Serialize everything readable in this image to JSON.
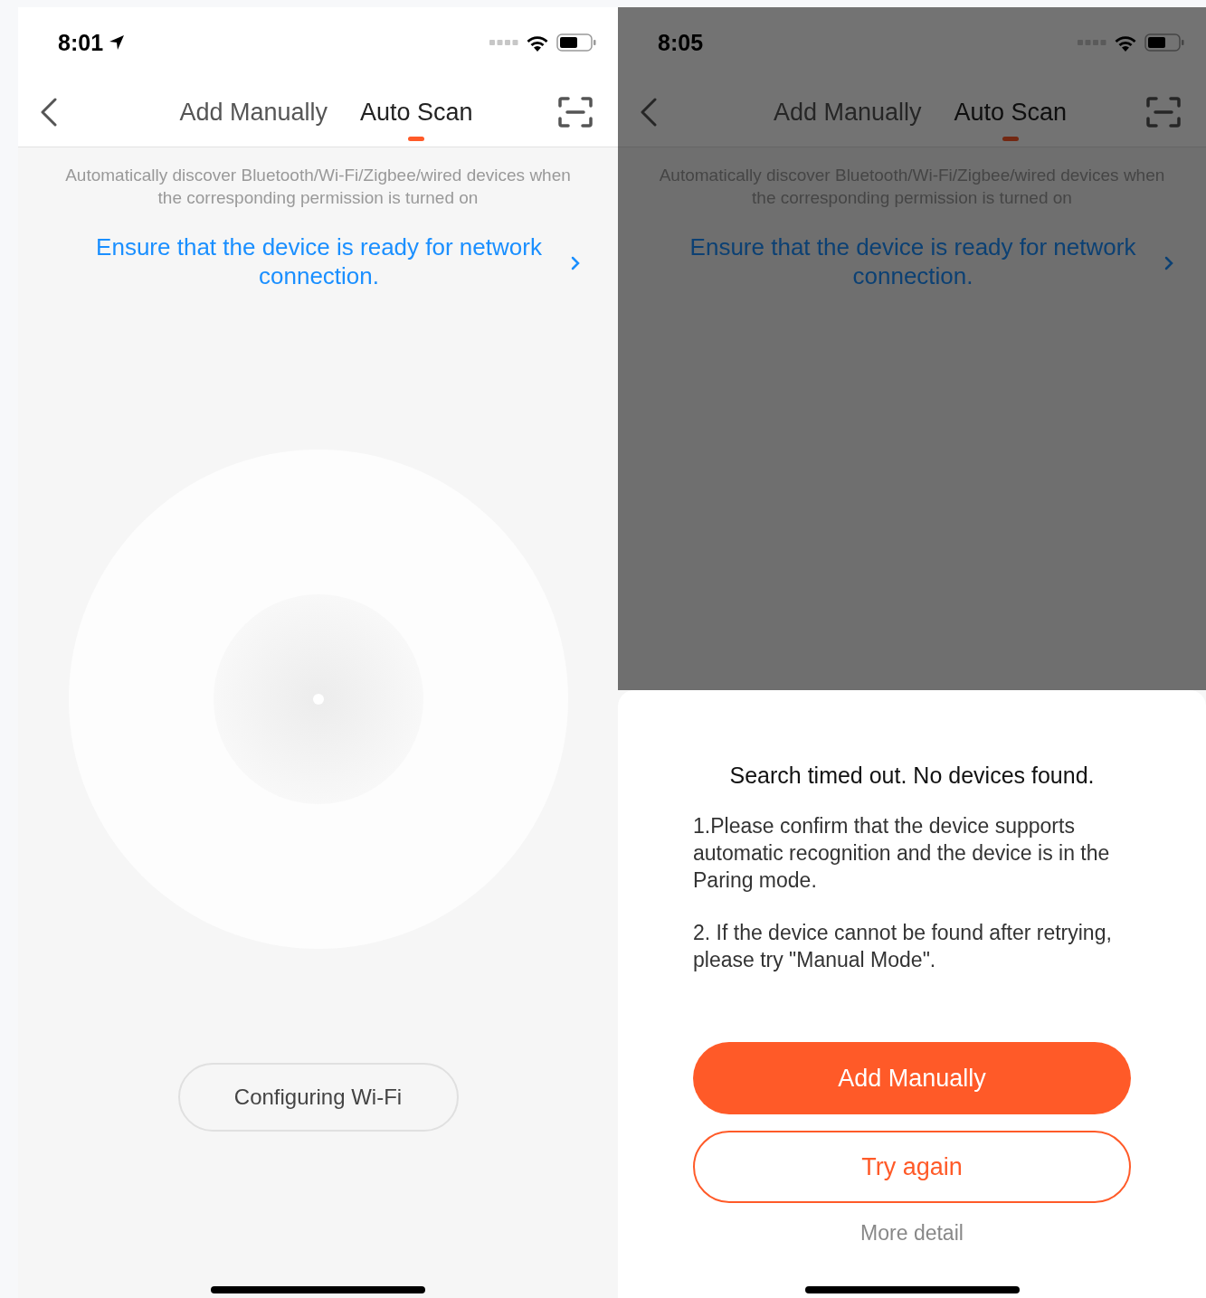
{
  "screens": [
    {
      "kind": "scanning",
      "status_bar": {
        "time": "8:01",
        "location": true
      },
      "tabs": [
        {
          "label": "Add Manually",
          "selected": false
        },
        {
          "label": "Auto Scan",
          "selected": true
        }
      ],
      "description": "Automatically discover Bluetooth/Wi-Fi/Zigbee/wired devices when the corresponding permission is turned on",
      "link": "Ensure that the device is ready for network connection.",
      "status_button": "Configuring Wi-Fi"
    },
    {
      "kind": "result",
      "status_bar": {
        "time": "8:05",
        "location": false
      },
      "tabs": [
        {
          "label": "Add Manually",
          "selected": false
        },
        {
          "label": "Auto Scan",
          "selected": true
        }
      ],
      "description": "Automatically discover Bluetooth/Wi-Fi/Zigbee/wired devices when the corresponding permission is turned on",
      "link": "Ensure that the device is ready for network connection.",
      "dialog": {
        "title": "Search timed out. No devices found.",
        "items": [
          "1.Please confirm that the device supports automatic recognition and the device is in the Paring mode.",
          "2. If the device cannot be found after retrying, please try \"Manual Mode\"."
        ],
        "buttons": [
          {
            "label": "Add Manually",
            "kind": "primary"
          },
          {
            "label": "Try again",
            "kind": "outline"
          }
        ],
        "link": "More detail"
      }
    }
  ]
}
